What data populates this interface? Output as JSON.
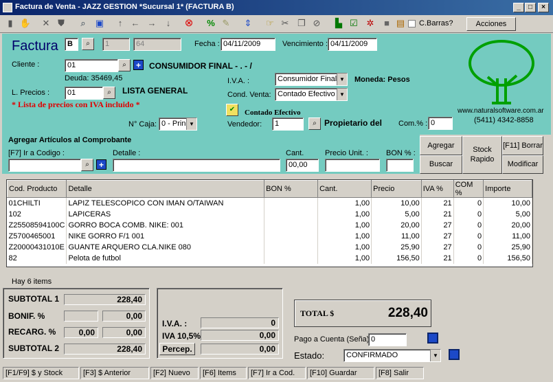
{
  "window": {
    "title": "Factura de Venta - JAZZ GESTION *Sucursal 1* (FACTURA B)"
  },
  "toolbar": {
    "cbarras_label": "C.Barras?",
    "acciones_label": "Acciones"
  },
  "factura": {
    "title": "Factura",
    "tipo": "B",
    "num1": "1",
    "num2": "64",
    "fecha_label": "Fecha :",
    "fecha": "04/11/2009",
    "venc_label": "Vencimiento :",
    "vencimiento": "04/11/2009",
    "cliente_label": "Cliente :",
    "cliente_code": "01",
    "cliente_name": "CONSUMIDOR FINAL - . - /",
    "deuda": "Deuda: 35469,45",
    "precios_label": "L. Precios :",
    "precios_code": "01",
    "precios_name": "LISTA GENERAL",
    "iva_note": "* Lista de precios con IVA incluido *",
    "iva_label": "I.V.A. :",
    "iva_value": "Consumidor Final",
    "moneda": "Moneda: Pesos",
    "cond_label": "Cond. Venta:",
    "cond_value": "Contado Efectivo",
    "contado_label": "Contado Efectivo",
    "caja_label": "N° Caja:",
    "caja_value": "0 - Prin",
    "vendedor_label": "Vendedor:",
    "vendedor_code": "1",
    "vendedor_name": "Propietario del",
    "com_label": "Com.% :",
    "com_value": "0",
    "web": "www.naturalsoftware.com.ar",
    "phone": "(5411) 4342-8858"
  },
  "agregar": {
    "title": "Agregar Artículos al Comprobante",
    "codigo_label": "[F7] Ir a Codigo :",
    "detalle_label": "Detalle :",
    "cant_label": "Cant.",
    "cant_value": "00,00",
    "precio_label": "Precio Unit. :",
    "bon_label": "BON % :",
    "btn_agregar": "Agregar",
    "btn_buscar": "Buscar",
    "btn_stock": "Stock Rapido",
    "btn_borrar": "[F11] Borrar",
    "btn_modificar": "Modificar"
  },
  "grid": {
    "headers": [
      "Cod. Producto",
      "Detalle",
      "BON %",
      "Cant.",
      "Precio",
      "IVA %",
      "COM %",
      "Importe"
    ],
    "rows": [
      [
        "01CHILTI",
        "LAPIZ TELESCOPICO CON IMAN O/TAIWAN",
        "",
        "1,00",
        "10,00",
        "21",
        "0",
        "10,00"
      ],
      [
        "102",
        "LAPICERAS",
        "",
        "1,00",
        "5,00",
        "21",
        "0",
        "5,00"
      ],
      [
        "Z25508594100C",
        "GORRO BOCA COMB.   NIKE: 001",
        "",
        "1,00",
        "20,00",
        "27",
        "0",
        "20,00"
      ],
      [
        "Z5700465001",
        "NIKE GORRO F/1 001",
        "",
        "1,00",
        "11,00",
        "27",
        "0",
        "11,00"
      ],
      [
        "Z20000431010E",
        "GUANTE ARQUERO CLA.NIKE 080",
        "",
        "1,00",
        "25,90",
        "27",
        "0",
        "25,90"
      ],
      [
        "82",
        "Pelota de futbol",
        "",
        "1,00",
        "156,50",
        "21",
        "0",
        "156,50"
      ]
    ]
  },
  "items_count": "Hay 6 items",
  "totals": {
    "subtotal1_label": "SUBTOTAL 1",
    "subtotal1": "228,40",
    "bonif_label": "BONIF. %",
    "bonif_pct": "",
    "bonif_val": "0,00",
    "recarg_label": "RECARG. %",
    "recarg_pct": "0,00",
    "recarg_val": "0,00",
    "subtotal2_label": "SUBTOTAL 2",
    "subtotal2": "228,40",
    "iva_label": "I.V.A. :",
    "iva_val": "0",
    "iva105_label": "IVA 10,5%",
    "iva105_val": "0,00",
    "percep_label": "Percep.",
    "percep_val": "0,00",
    "total_label": "TOTAL $",
    "total": "228,40",
    "pago_label": "Pago a Cuenta (Seña)",
    "pago_val": "0",
    "estado_label": "Estado:",
    "estado_val": "CONFIRMADO"
  },
  "status": [
    "[F1/F9] $ y Stock",
    "[F3] $ Anterior",
    "[F2] Nuevo",
    "[F6] Items",
    "[F7] Ir a Cod.",
    "[F10] Guardar",
    "[F8] Salir"
  ]
}
